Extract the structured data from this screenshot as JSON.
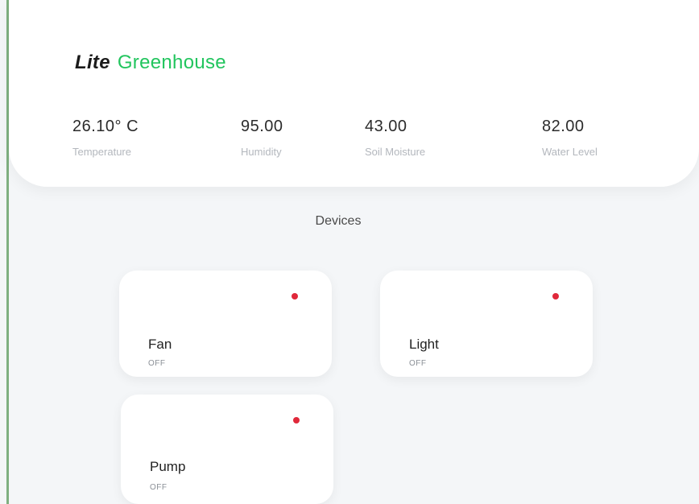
{
  "app": {
    "brand_italic": "Lite",
    "brand_name": "Greenhouse",
    "accent_color": "#22c55e",
    "alert_color": "#e0283a"
  },
  "stats": [
    {
      "value": "26.10° C",
      "label": "Temperature"
    },
    {
      "value": "95.00",
      "label": "Humidity"
    },
    {
      "value": "43.00",
      "label": "Soil Moisture"
    },
    {
      "value": "82.00",
      "label": "Water Level"
    }
  ],
  "devices_section": {
    "title": "Devices",
    "items": [
      {
        "name": "Fan",
        "state": "OFF",
        "indicator": "status-dot-red"
      },
      {
        "name": "Light",
        "state": "OFF",
        "indicator": "status-dot-red"
      },
      {
        "name": "Pump",
        "state": "OFF",
        "indicator": "status-dot-red"
      }
    ]
  }
}
